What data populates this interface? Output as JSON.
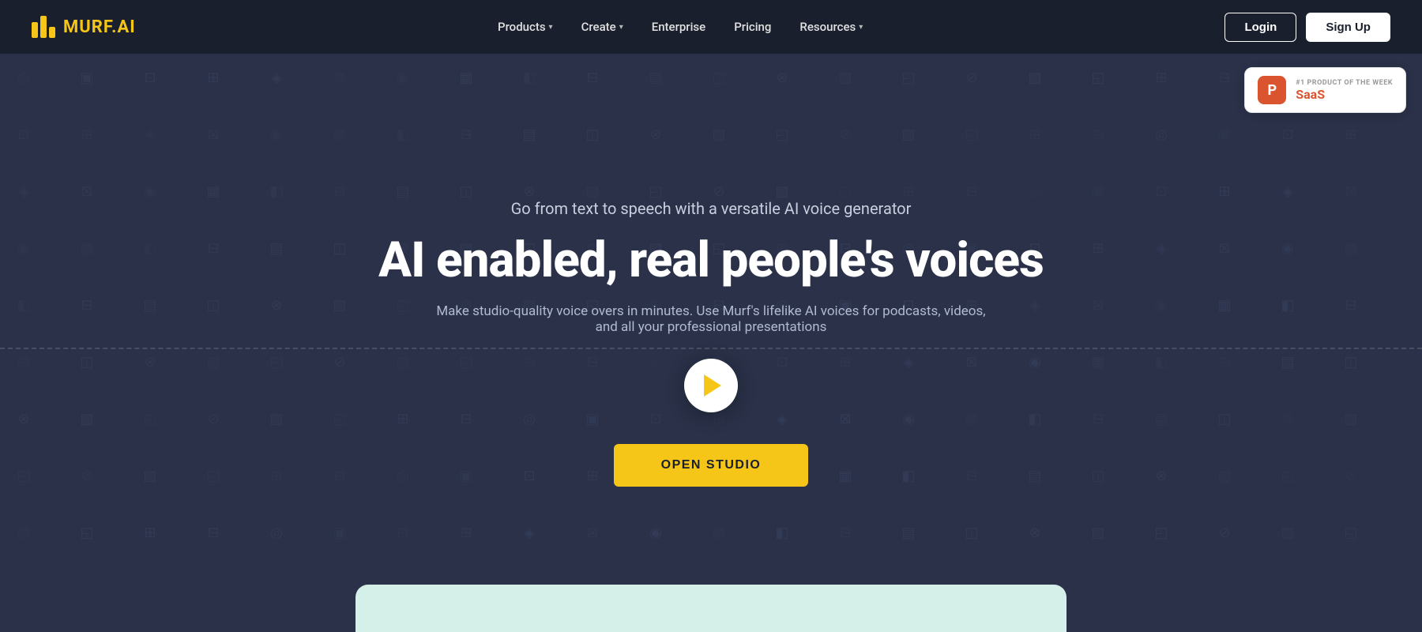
{
  "brand": {
    "name": "MURF",
    "suffix": ".AI"
  },
  "navbar": {
    "products_label": "Products",
    "create_label": "Create",
    "enterprise_label": "Enterprise",
    "pricing_label": "Pricing",
    "resources_label": "Resources",
    "login_label": "Login",
    "signup_label": "Sign Up"
  },
  "hero": {
    "subtitle": "Go from text to speech with a versatile AI voice generator",
    "title": "AI enabled, real people's voices",
    "description": "Make studio-quality voice overs in minutes. Use Murf's lifelike AI voices for podcasts, videos, and all your professional presentations",
    "cta_label": "OPEN STUDIO"
  },
  "product_hunt": {
    "badge_label": "#1 PRODUCT OF THE WEEK",
    "product_name": "SaaS",
    "logo_letter": "P"
  },
  "icons": {
    "play": "▶",
    "chevron_down": "▾"
  }
}
